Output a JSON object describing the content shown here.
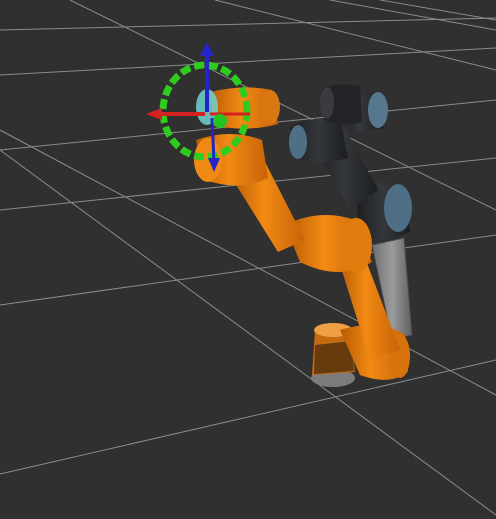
{
  "scene": {
    "background_color": "#303030",
    "grid_color": "#a0a0a0",
    "planned_arm_color": "#e8790a",
    "current_arm_color": "#2b2d30",
    "current_arm_joint_color": "#5a7d96",
    "marker_ring_color": "#2ecc1f",
    "axis_colors": {
      "x": "#d42020",
      "y": "#22c422",
      "z": "#2222c8"
    }
  }
}
